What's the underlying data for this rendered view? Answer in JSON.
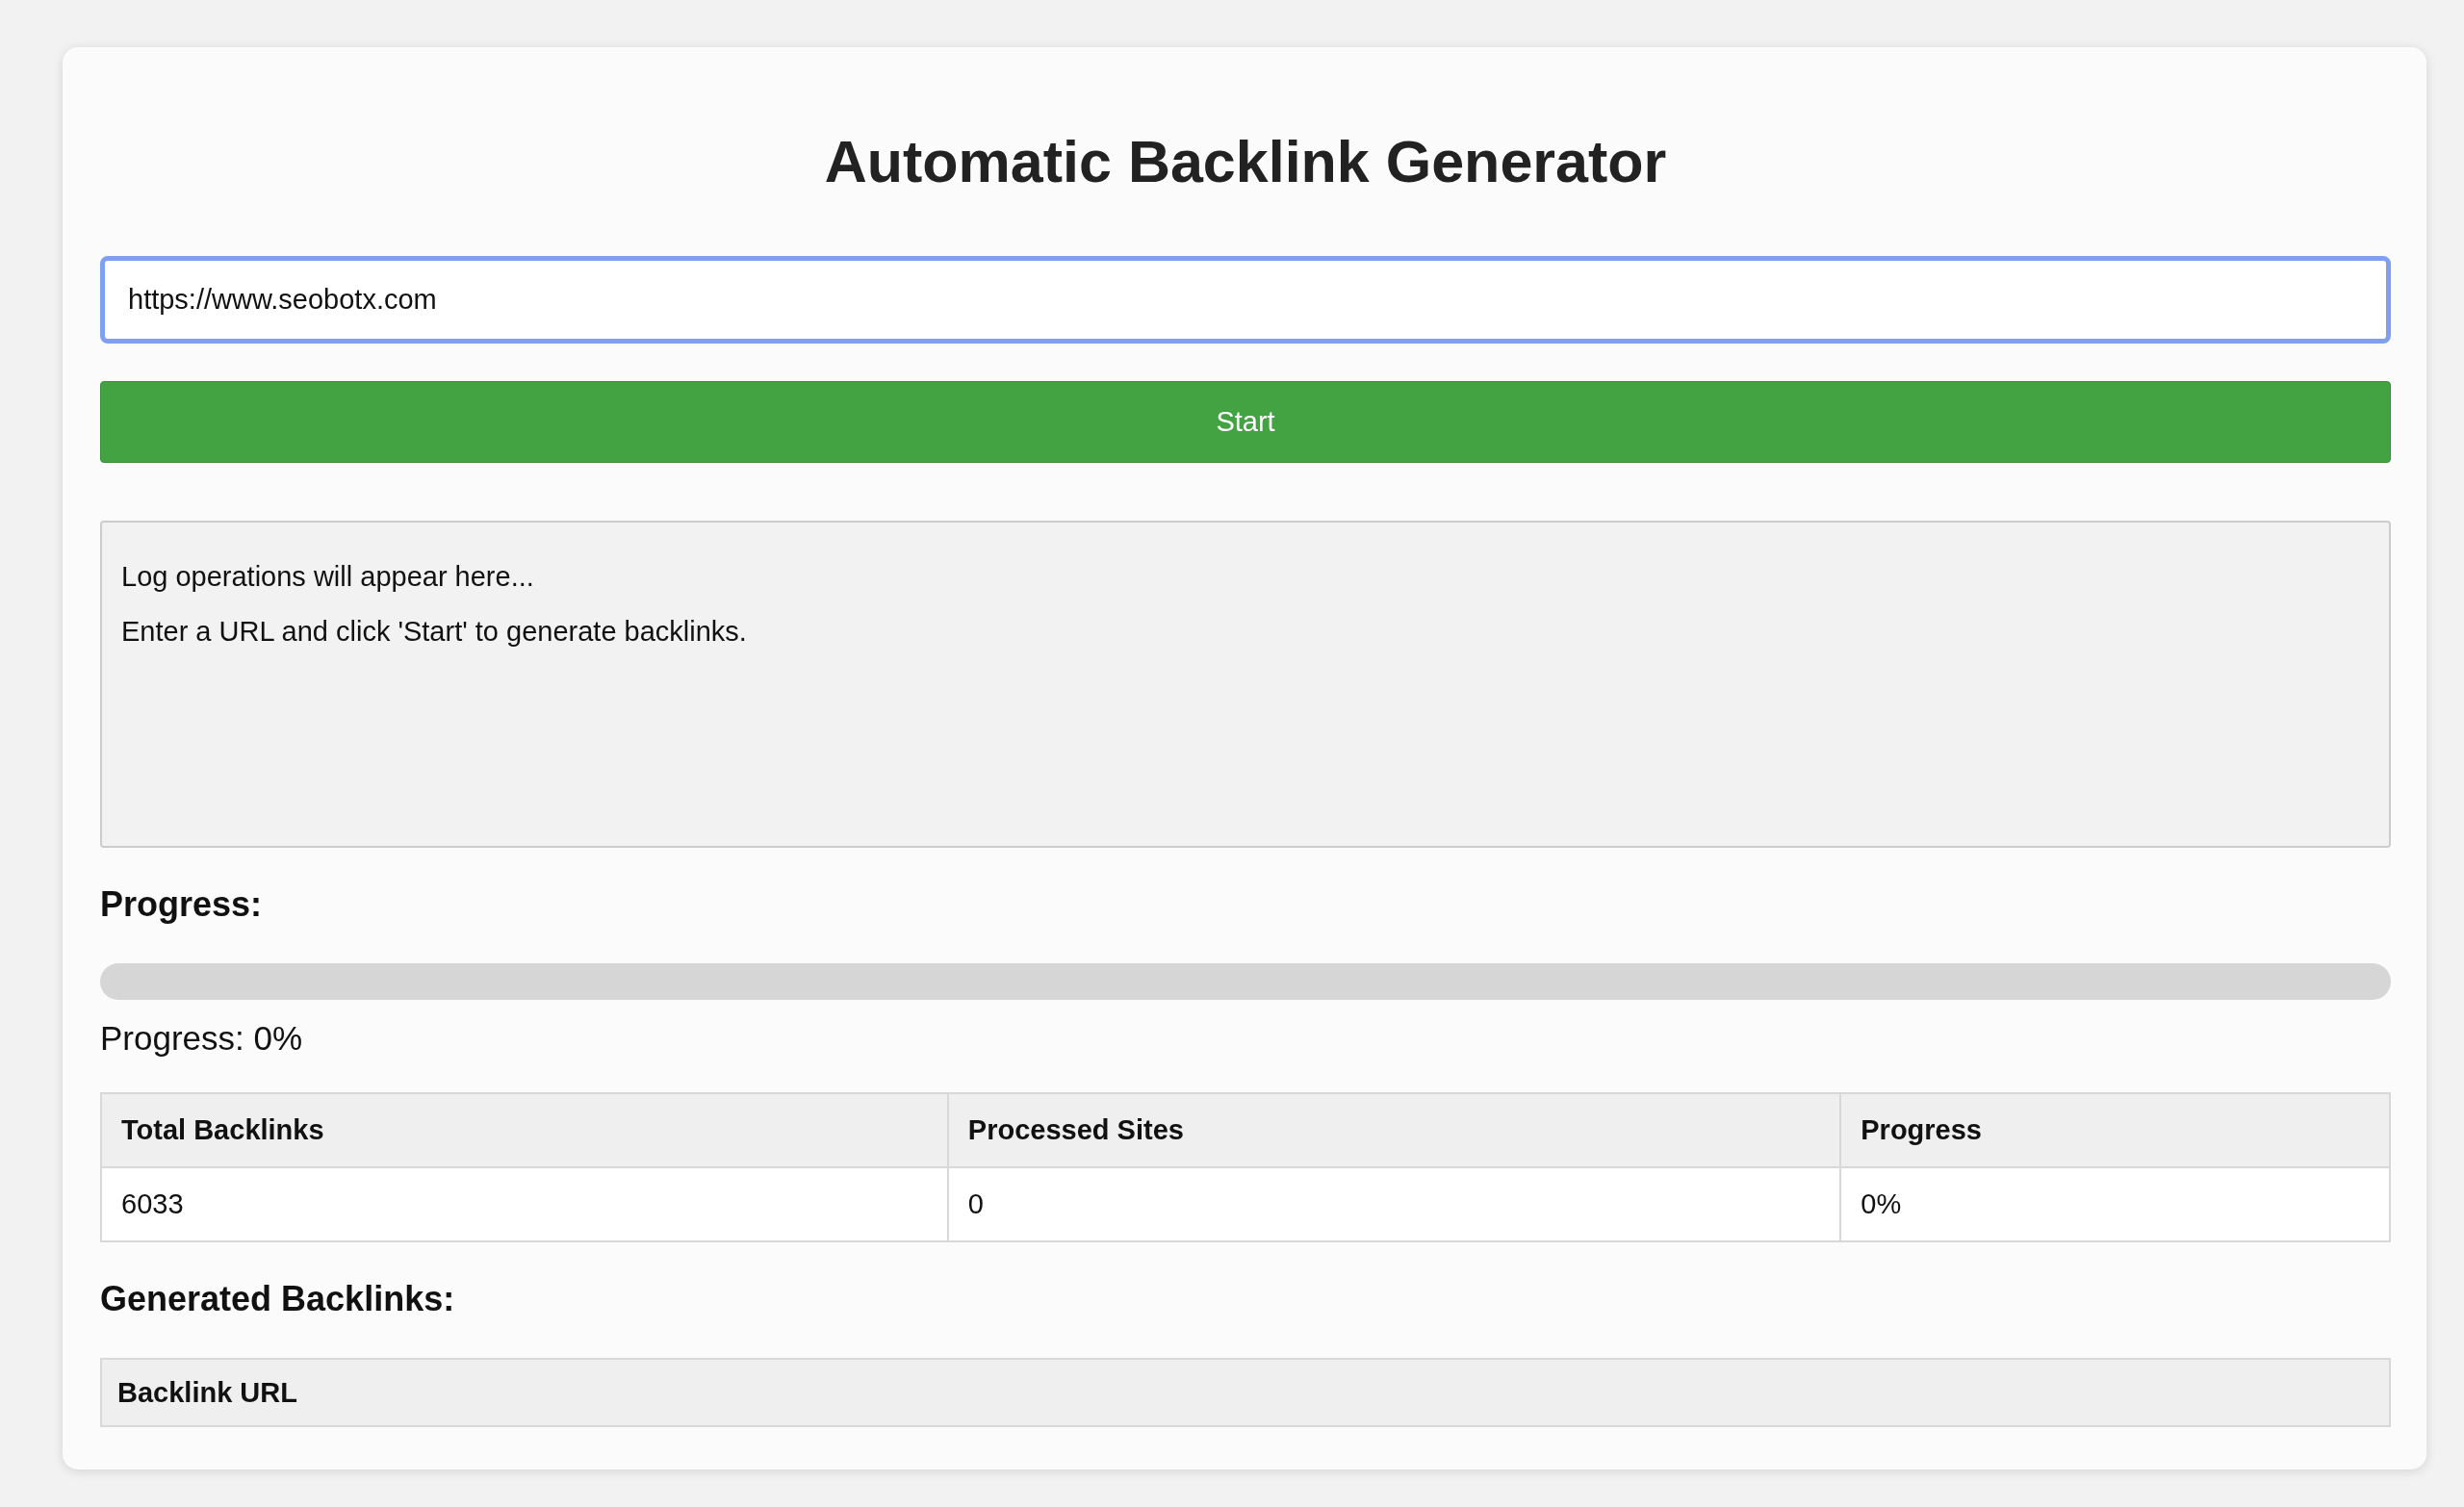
{
  "title": "Automatic Backlink Generator",
  "url_field": {
    "value": "https://www.seobotx.com",
    "focused": true
  },
  "start_button": {
    "label": "Start"
  },
  "log": [
    "Log operations will appear here...",
    "Enter a URL and click 'Start' to generate backlinks."
  ],
  "progress": {
    "heading": "Progress:",
    "level": 0,
    "reading": "Progress: 0%"
  },
  "stats_table": {
    "columns": [
      "Total Backlinks",
      "Processed Sites",
      "Progress"
    ],
    "rows": [
      [
        "6033",
        "0",
        "0%"
      ]
    ]
  },
  "backlinks": {
    "heading": "Generated Backlinks:",
    "columns": [
      "Backlink URL"
    ]
  }
}
